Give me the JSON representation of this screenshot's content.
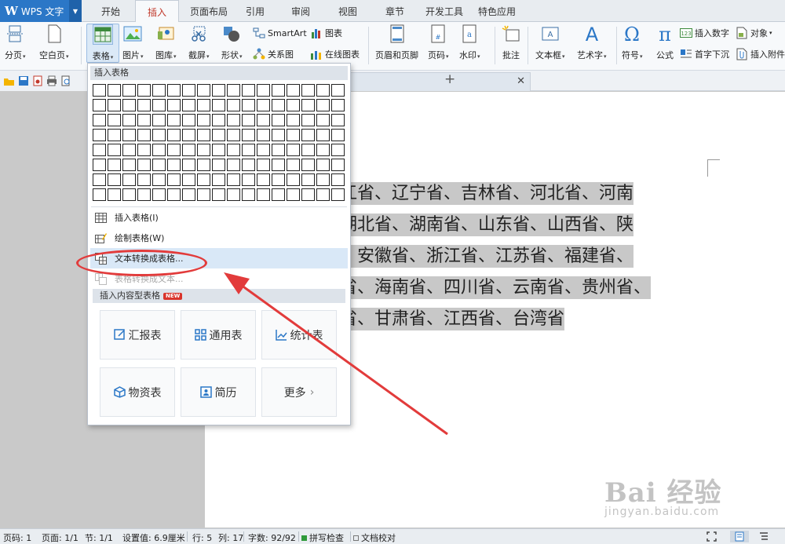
{
  "app": {
    "logo": "W",
    "name": "WPS 文字"
  },
  "tabs": [
    "开始",
    "插入",
    "页面布局",
    "引用",
    "审阅",
    "视图",
    "章节",
    "开发工具",
    "特色应用"
  ],
  "active_tab": "插入",
  "ribbon": {
    "page_break": "分页",
    "blank_page": "空白页",
    "table": "表格",
    "picture": "图片",
    "gallery": "图库",
    "screenshot": "截屏",
    "shapes": "形状",
    "smartart": "SmartArt",
    "chart": "图表",
    "relation_chart": "关系图",
    "online_chart": "在线图表",
    "header_footer": "页眉和页脚",
    "page_number": "页码",
    "watermark": "水印",
    "comment": "批注",
    "textbox": "文本框",
    "wordart": "艺术字",
    "symbol": "符号",
    "formula": "公式",
    "insert_number": "插入数字",
    "object": "对象",
    "drop_cap": "首字下沉",
    "attachment": "插入附件"
  },
  "dropdown": {
    "header": "插入表格",
    "items": [
      {
        "label": "插入表格(I)"
      },
      {
        "label": "绘制表格(W)"
      },
      {
        "label": "文本转换成表格..."
      },
      {
        "label": "表格转换成文本..."
      }
    ],
    "section": "插入内容型表格",
    "badge": "NEW",
    "templates": [
      "汇报表",
      "通用表",
      "统计表",
      "物资表",
      "简历",
      "更多"
    ]
  },
  "document": {
    "lines": [
      "江省、辽宁省、吉林省、河北省、河南",
      "湖北省、湖南省、山东省、山西省、陕",
      "、安徽省、浙江省、江苏省、福建省、",
      "省、海南省、四川省、云南省、贵州省、",
      "省、甘肃省、江西省、台湾省"
    ]
  },
  "status": {
    "page_num": "页码: 1",
    "pages": "页面: 1/1",
    "section": "节: 1/1",
    "setting": "设置值: 6.9厘米",
    "row": "行: 5",
    "col": "列: 17",
    "words": "字数: 92/92",
    "spell_check": "拼写检查",
    "doc_proof": "文档校对"
  },
  "watermark": {
    "logo_text": "Bai 经验",
    "url": "jingyan.baidu.com"
  },
  "colors": {
    "accent": "#2b77c7",
    "active_tab_text": "#c1392b",
    "annotation": "#e23b3b",
    "highlight": "#d9e8f7"
  }
}
